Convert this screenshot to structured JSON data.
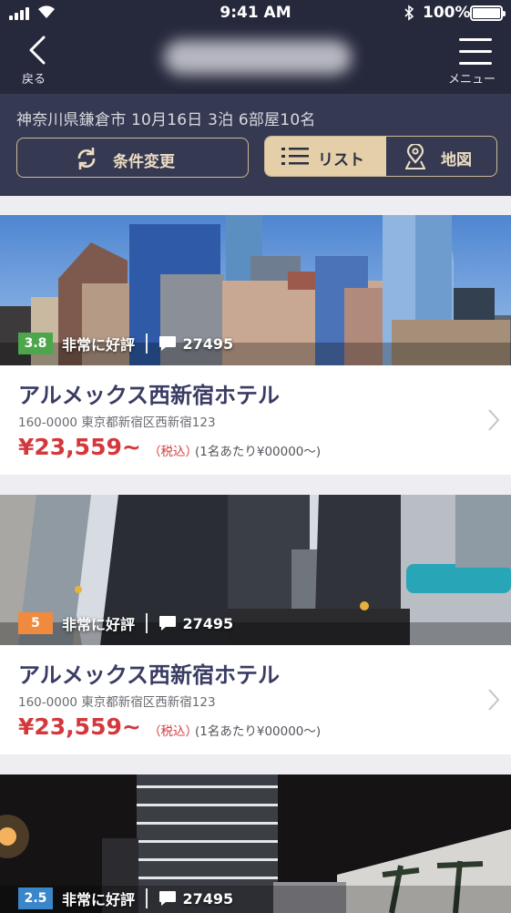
{
  "status_bar": {
    "time": "9:41 AM",
    "battery": "100%"
  },
  "header": {
    "back_label": "戻る",
    "menu_label": "メニュー"
  },
  "search": {
    "summary": "神奈川県鎌倉市 10月16日 3泊 6部屋10名",
    "change_conditions": "条件変更",
    "view_list": "リスト",
    "view_map": "地図",
    "active_view": "list"
  },
  "colors": {
    "header_bg": "#26283c",
    "subbar_bg": "#353a52",
    "accent": "#e5cfa8",
    "price": "#d4383c",
    "name": "#3a3c63"
  },
  "hotels": [
    {
      "score": "3.8",
      "score_color": "#4ca64a",
      "review_label": "非常に好評",
      "review_count": "27495",
      "name": "アルメックス西新宿ホテル",
      "address": "160-0000 東京都新宿区西新宿123",
      "price": "¥23,559~",
      "tax": "（税込）",
      "per_person": "(1名あたり¥00000〜)"
    },
    {
      "score": "5",
      "score_color": "#f08a3e",
      "review_label": "非常に好評",
      "review_count": "27495",
      "name": "アルメックス西新宿ホテル",
      "address": "160-0000 東京都新宿区西新宿123",
      "price": "¥23,559~",
      "tax": "（税込）",
      "per_person": "(1名あたり¥00000〜)"
    },
    {
      "score": "2.5",
      "score_color": "#3b86c9",
      "review_label": "非常に好評",
      "review_count": "27495"
    }
  ]
}
